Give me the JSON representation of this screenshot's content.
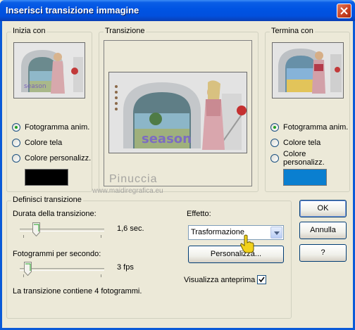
{
  "window": {
    "title": "Inserisci transizione immagine"
  },
  "groups": {
    "start": "Inizia con",
    "transition": "Transizione",
    "end": "Termina con",
    "define": "Definisci transizione"
  },
  "start_options": [
    {
      "label": "Fotogramma anim.",
      "selected": true
    },
    {
      "label": "Colore tela",
      "selected": false
    },
    {
      "label": "Colore personalizz.",
      "selected": false
    }
  ],
  "end_options": [
    {
      "label": "Fotogramma anim.",
      "selected": true
    },
    {
      "label": "Colore tela",
      "selected": false
    },
    {
      "label": "Colore personalizz.",
      "selected": false
    }
  ],
  "colors": {
    "start_custom": "#000000",
    "end_custom": "#0a7fd0"
  },
  "preview": {
    "text": "season"
  },
  "duration": {
    "label": "Durata della transizione:",
    "value": "1,6 sec."
  },
  "fps": {
    "label": "Fotogrammi per secondo:",
    "value": "3 fps"
  },
  "frames_info": "La transizione contiene 4 fotogrammi.",
  "effect": {
    "label": "Effetto:",
    "selected": "Trasformazione"
  },
  "buttons": {
    "customize": "Personalizza...",
    "ok": "OK",
    "cancel": "Annulla",
    "help": "?"
  },
  "preview_check": {
    "label": "Visualizza anteprima",
    "checked": true
  },
  "watermark": {
    "name": "Pinuccia",
    "url": "www.maidiregrafica.eu"
  }
}
